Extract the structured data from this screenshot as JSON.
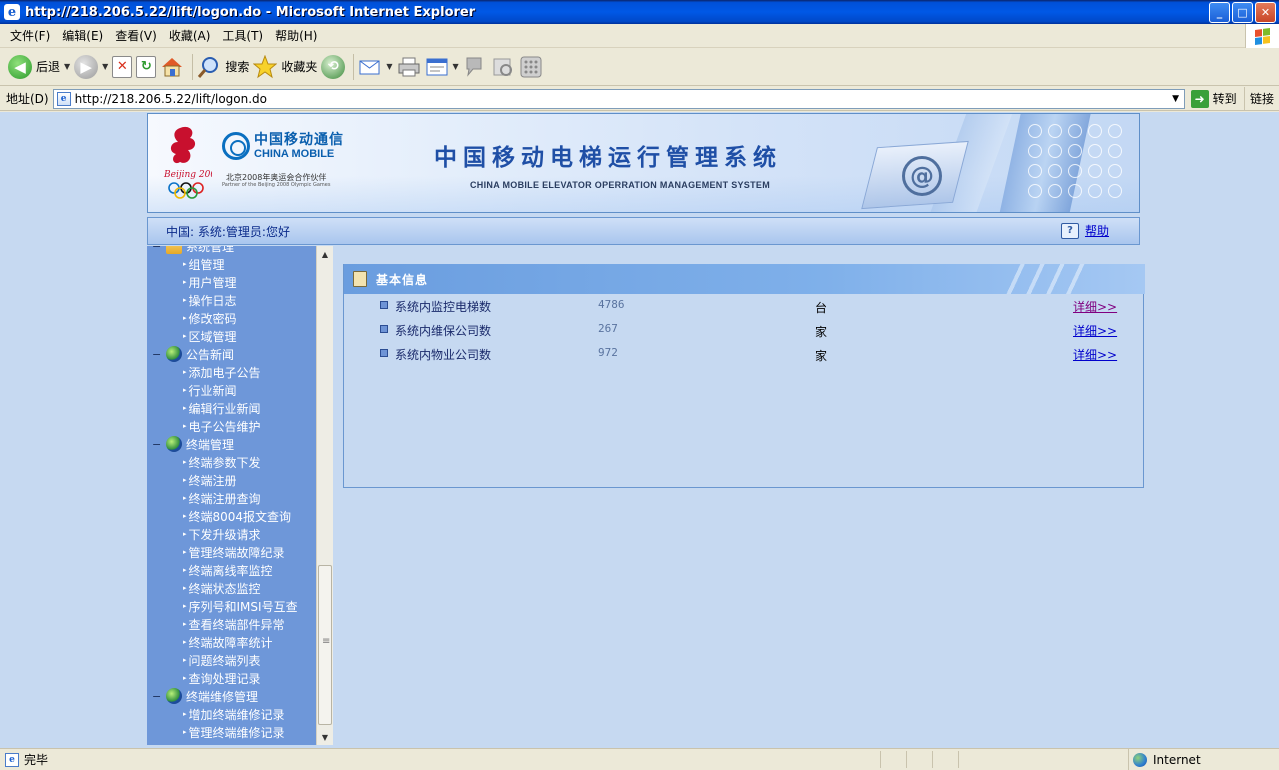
{
  "window": {
    "title": "http://218.206.5.22/lift/logon.do - Microsoft Internet Explorer",
    "minimize": "_",
    "maximize": "□",
    "close": "✕"
  },
  "menu": [
    "文件(F)",
    "编辑(E)",
    "查看(V)",
    "收藏(A)",
    "工具(T)",
    "帮助(H)"
  ],
  "toolbar": {
    "back_label": "后退",
    "search_label": "搜索",
    "favorites_label": "收藏夹"
  },
  "address": {
    "label": "地址(D)",
    "url": "http://218.206.5.22/lift/logon.do",
    "go_label": "转到",
    "links_label": "链接"
  },
  "banner": {
    "cm_cn": "中国移动通信",
    "cm_en": "CHINA MOBILE",
    "partner_cn": "北京2008年奥运会合作伙伴",
    "partner_en": "Partner of the Beijing 2008 Olympic Games",
    "system_title": "中国移动电梯运行管理系统",
    "system_en": "CHINA MOBILE ELEVATOR OPERRATION MANAGEMENT SYSTEM"
  },
  "userbar": {
    "greeting": "中国: 系统:管理员:您好",
    "help": "帮助"
  },
  "nav": [
    {
      "type": "group",
      "label": "系统管理",
      "icon": "folder"
    },
    {
      "type": "child",
      "label": "组管理"
    },
    {
      "type": "child",
      "label": "用户管理"
    },
    {
      "type": "child",
      "label": "操作日志"
    },
    {
      "type": "child",
      "label": "修改密码"
    },
    {
      "type": "child",
      "label": "区域管理"
    },
    {
      "type": "group",
      "label": "公告新闻",
      "icon": "globe"
    },
    {
      "type": "child",
      "label": "添加电子公告"
    },
    {
      "type": "child",
      "label": "行业新闻"
    },
    {
      "type": "child",
      "label": "编辑行业新闻"
    },
    {
      "type": "child",
      "label": "电子公告维护"
    },
    {
      "type": "group",
      "label": "终端管理",
      "icon": "globe"
    },
    {
      "type": "child",
      "label": "终端参数下发"
    },
    {
      "type": "child",
      "label": "终端注册"
    },
    {
      "type": "child",
      "label": "终端注册查询"
    },
    {
      "type": "child",
      "label": "终端8004报文查询"
    },
    {
      "type": "child",
      "label": "下发升级请求"
    },
    {
      "type": "child",
      "label": "管理终端故障纪录"
    },
    {
      "type": "child",
      "label": "终端离线率监控"
    },
    {
      "type": "child",
      "label": "终端状态监控"
    },
    {
      "type": "child",
      "label": "序列号和IMSI号互查"
    },
    {
      "type": "child",
      "label": "查看终端部件异常"
    },
    {
      "type": "child",
      "label": "终端故障率统计"
    },
    {
      "type": "child",
      "label": "问题终端列表"
    },
    {
      "type": "child",
      "label": "查询处理记录"
    },
    {
      "type": "group",
      "label": "终端维修管理",
      "icon": "globe"
    },
    {
      "type": "child",
      "label": "增加终端维修记录"
    },
    {
      "type": "child",
      "label": "管理终端维修记录"
    }
  ],
  "panel": {
    "title": "基本信息",
    "rows": [
      {
        "name": "系统内监控电梯数",
        "value": "4786",
        "unit": "台",
        "detail": "详细>>",
        "visited": true
      },
      {
        "name": "系统内维保公司数",
        "value": "267",
        "unit": "家",
        "detail": "详细>>",
        "visited": false
      },
      {
        "name": "系统内物业公司数",
        "value": "972",
        "unit": "家",
        "detail": "详细>>",
        "visited": false
      }
    ]
  },
  "status": {
    "text": "完毕",
    "zone": "Internet"
  }
}
